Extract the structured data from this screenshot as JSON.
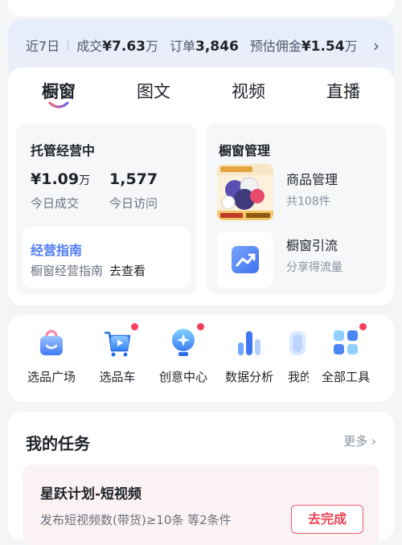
{
  "stats": {
    "period": "近7日",
    "items": [
      {
        "label": "成交",
        "value": "¥7.63",
        "unit": "万"
      },
      {
        "label": "订单",
        "value": "3,846",
        "unit": ""
      },
      {
        "label": "预估佣金",
        "value": "¥1.54",
        "unit": "万"
      }
    ],
    "more_icon": "chevron-right-icon"
  },
  "tabs": [
    "橱窗",
    "图文",
    "视频",
    "直播"
  ],
  "active_tab": 0,
  "managed": {
    "title": "托管经营中",
    "metrics": [
      {
        "value": "¥1.09",
        "unit": "万",
        "label": "今日成交"
      },
      {
        "value": "1,577",
        "unit": "",
        "label": "今日访问"
      }
    ],
    "guide": {
      "title": "经营指南",
      "desc": "橱窗经营指南",
      "link": "去查看"
    }
  },
  "showcase": {
    "title": "橱窗管理",
    "items": [
      {
        "title": "商品管理",
        "sub": "共108件"
      },
      {
        "title": "橱窗引流",
        "sub": "分享得流量"
      }
    ]
  },
  "tools": [
    {
      "label": "选品广场",
      "icon": "shopping-bag-icon",
      "badge": false
    },
    {
      "label": "选品车",
      "icon": "cart-icon",
      "badge": true
    },
    {
      "label": "创意中心",
      "icon": "lightbulb-icon",
      "badge": true
    },
    {
      "label": "数据分析",
      "icon": "bar-chart-icon",
      "badge": false
    },
    {
      "label": "我的",
      "icon": "profile-icon",
      "badge": false
    },
    {
      "label": "全部工具",
      "icon": "grid-icon",
      "badge": true
    }
  ],
  "tasks": {
    "title": "我的任务",
    "more": "更多",
    "items": [
      {
        "name": "星跃计划-短视频",
        "desc": "发布短视频数(带货)≥10条  等2条件",
        "action": "去完成"
      }
    ]
  },
  "colors": {
    "accent": "#4d7cf4",
    "badge": "#f53f5b",
    "task_action": "#f04357"
  }
}
